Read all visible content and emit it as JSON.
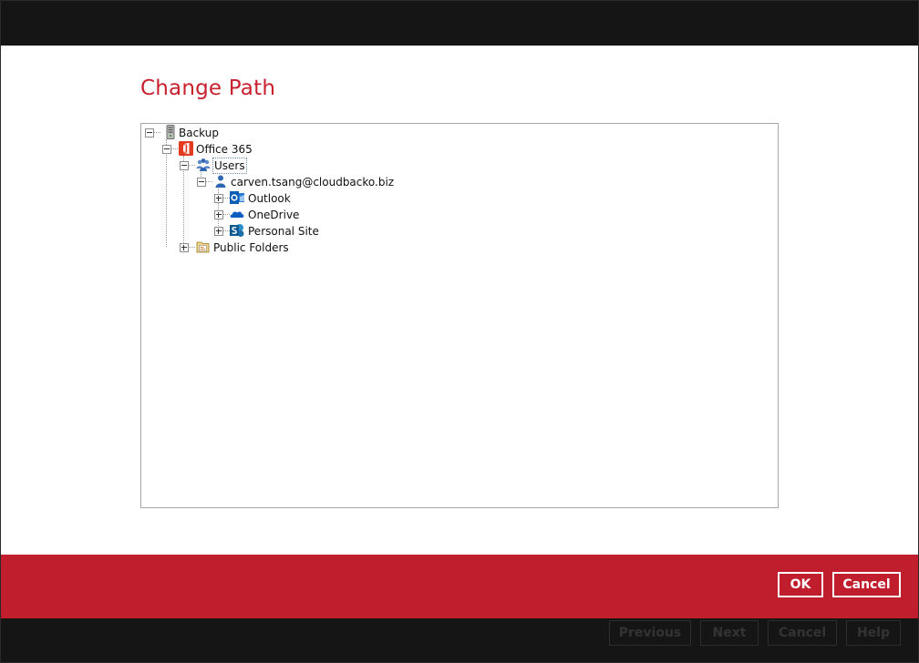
{
  "dialog": {
    "title": "Change Path"
  },
  "tree": {
    "backup": "Backup",
    "office365": "Office 365",
    "users": "Users",
    "user_email": "carven.tsang@cloudbacko.biz",
    "outlook": "Outlook",
    "onedrive": "OneDrive",
    "personal_site": "Personal Site",
    "public_folders": "Public Folders"
  },
  "buttons": {
    "ok": "OK",
    "cancel": "Cancel"
  },
  "background_wizard": {
    "previous": "Previous",
    "next": "Next",
    "cancel": "Cancel",
    "help": "Help"
  },
  "colors": {
    "accent": "#c11e2d",
    "title": "#c8202f"
  }
}
